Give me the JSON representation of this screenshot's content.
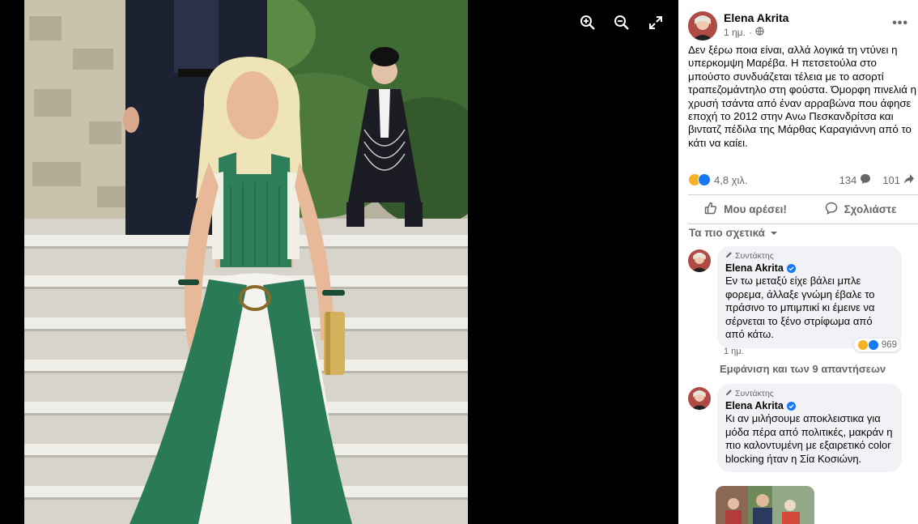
{
  "viewer": {
    "zoom_in_icon": "zoom-in-icon",
    "zoom_out_icon": "zoom-out-icon",
    "fullscreen_icon": "fullscreen-icon"
  },
  "post": {
    "author": "Elena Akrita",
    "time": "1 ημ.",
    "privacy_icon": "globe-icon",
    "more_icon": "more-icon",
    "text": "Δεν ξέρω ποια είναι, αλλά λογικά τη ντύνει η υπερκομψη Μαρέβα. Η πετσετούλα στο μπούστο συνδυάζεται τέλεια με το ασορτί τραπεζομάντηλο στη φούστα. Όμορφη πινελιά η χρυσή τσάντα από έναν αρραβώνα που άφησε εποχή το 2012 στην Ανω Πεσκανδρίτσα και βιντατζ πέδιλα της Μάρθας Καραγιάννη από το κάτι να καίει.",
    "reactions_count": "4,8 χιλ.",
    "comments_count": "134",
    "shares_count": "101",
    "like_label": "Μου αρέσει!",
    "comment_label": "Σχολιάστε",
    "sort_label": "Τα πιο σχετικά"
  },
  "comments": [
    {
      "badge": "Συντάκτης",
      "author": "Elena Akrita",
      "text": "Εν τω μεταξύ είχε βάλει μπλε φορεμα, άλλαξε γνώμη έβαλε το πράσινο το μπιμπικί κι έμεινε να σέρνεται το ξένο στρίφωμα από από κάτω.",
      "time": "1 ημ.",
      "reactions": "969"
    },
    {
      "badge": "Συντάκτης",
      "author": "Elena Akrita",
      "text": "Κι αν μιλήσουμε αποκλειστικα για μόδα πέρα από πολιτικές, μακράν η πιο καλοντυμένη με εξαιρετικό color blocking ήταν η Σία Κοσιώνη."
    }
  ],
  "view_replies": "Εμφάνιση και των 9 απαντήσεων",
  "colors": {
    "accent": "#1877f2",
    "text_secondary": "#65676b",
    "bubble": "#f0f2f5",
    "top_green": "#2e7d5b"
  }
}
